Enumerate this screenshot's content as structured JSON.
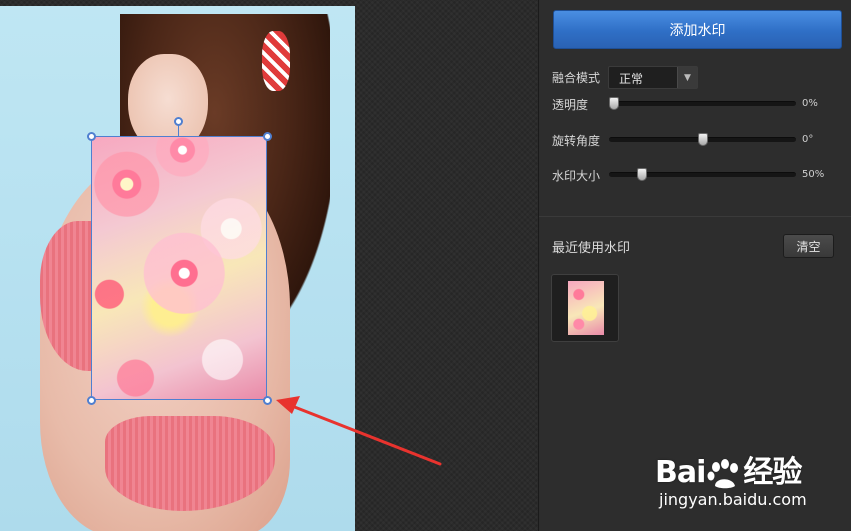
{
  "panel": {
    "add_watermark_label": "添加水印",
    "blend_mode": {
      "label": "融合模式",
      "value": "正常"
    },
    "opacity": {
      "label": "透明度",
      "value": 0,
      "display": "0%"
    },
    "rotation": {
      "label": "旋转角度",
      "value": 0,
      "display": "0°"
    },
    "size": {
      "label": "水印大小",
      "value": 50,
      "display": "50%"
    },
    "recent": {
      "title": "最近使用水印",
      "clear_label": "清空"
    }
  },
  "site_watermark": {
    "brand_a": "Bai",
    "brand_b": "经验",
    "url": "jingyan.baidu.com"
  },
  "colors": {
    "accent_blue": "#2f6fc6",
    "selection": "#4f7fd0",
    "arrow": "#e8332e"
  }
}
